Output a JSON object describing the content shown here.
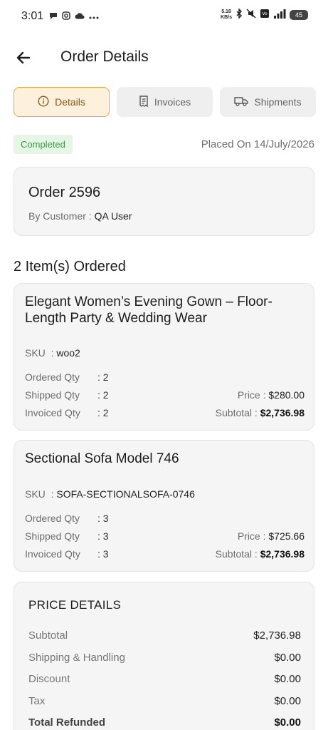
{
  "status_bar": {
    "time": "3:01",
    "net_speed_value": "5.18",
    "net_speed_unit": "KB/s",
    "battery": "45"
  },
  "header": {
    "title": "Order Details"
  },
  "tabs": [
    {
      "label": "Details",
      "active": true
    },
    {
      "label": "Invoices",
      "active": false
    },
    {
      "label": "Shipments",
      "active": false
    }
  ],
  "order_status": {
    "badge": "Completed",
    "placed_on": "Placed On 14/July/2026"
  },
  "order": {
    "title": "Order 2596",
    "customer_label": "By Customer :",
    "customer_name": "QA User"
  },
  "items_heading": "2 Item(s) Ordered",
  "items": [
    {
      "name": "Elegant Women’s Evening Gown – Floor-Length Party & Wedding Wear",
      "sku_label": "SKU",
      "sku": "woo2",
      "ordered_label": "Ordered Qty",
      "ordered_qty": ": 2",
      "shipped_label": "Shipped Qty",
      "shipped_qty": ": 2",
      "invoiced_label": "Invoiced Qty",
      "invoiced_qty": ": 2",
      "price_label": "Price :",
      "price": "$280.00",
      "subtotal_label": "Subtotal :",
      "subtotal": "$2,736.98"
    },
    {
      "name": "Sectional Sofa Model 746",
      "sku_label": "SKU",
      "sku": "SOFA-SECTIONALSOFA-0746",
      "ordered_label": "Ordered Qty",
      "ordered_qty": ": 3",
      "shipped_label": "Shipped Qty",
      "shipped_qty": ": 3",
      "invoiced_label": "Invoiced Qty",
      "invoiced_qty": ": 3",
      "price_label": "Price :",
      "price": "$725.66",
      "subtotal_label": "Subtotal :",
      "subtotal": "$2,736.98"
    }
  ],
  "price_details": {
    "title": "PRICE DETAILS",
    "rows": [
      {
        "label": "Subtotal",
        "value": "$2,736.98"
      },
      {
        "label": "Shipping & Handling",
        "value": "$0.00"
      },
      {
        "label": "Discount",
        "value": "$0.00"
      },
      {
        "label": "Tax",
        "value": "$0.00"
      },
      {
        "label": "Total Refunded",
        "value": "$0.00"
      }
    ]
  },
  "colors": {
    "accent": "#e9a640",
    "accent_bg": "#fdf0dc",
    "status_green": "#3a9a46",
    "status_green_bg": "#e6f6e6"
  }
}
